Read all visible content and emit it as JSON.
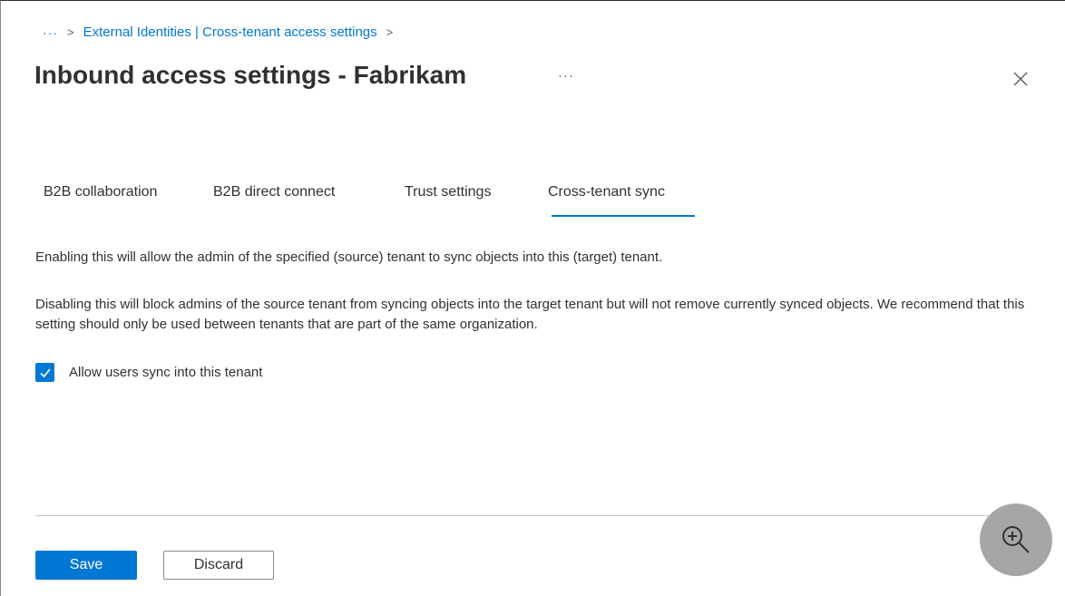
{
  "breadcrumb": {
    "more": "···",
    "separator": ">",
    "link": "External Identities | Cross-tenant access settings"
  },
  "header": {
    "title": "Inbound access settings - Fabrikam",
    "more": "···",
    "close_icon": "close-icon"
  },
  "tabs": [
    {
      "label": "B2B collaboration",
      "active": false
    },
    {
      "label": "B2B direct connect",
      "active": false
    },
    {
      "label": "Trust settings",
      "active": false
    },
    {
      "label": "Cross-tenant sync",
      "active": true
    }
  ],
  "content": {
    "paragraph1": "Enabling this will allow the admin of the specified (source) tenant to sync objects into this (target) tenant.",
    "paragraph2": "Disabling this will block admins of the source tenant from syncing objects into the target tenant but will not remove currently synced objects. We recommend that this setting should only be used between tenants that are part of the same organization.",
    "checkbox": {
      "label": "Allow users sync into this tenant",
      "checked": true
    }
  },
  "footer": {
    "save_label": "Save",
    "discard_label": "Discard"
  },
  "overlay": {
    "zoom_icon": "zoom-in-icon"
  },
  "colors": {
    "accent": "#0078d4",
    "text": "#323130",
    "overlay": "#a6a6a6"
  }
}
